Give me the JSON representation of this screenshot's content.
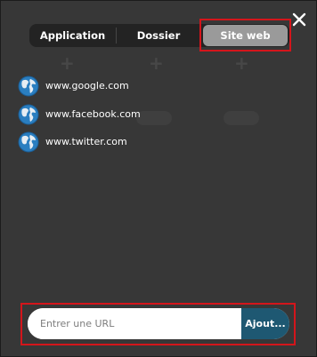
{
  "tabs": {
    "application": "Application",
    "folder": "Dossier",
    "website": "Site web",
    "selected": "website"
  },
  "sites": [
    {
      "label": "www.google.com",
      "icon": "globe-icon"
    },
    {
      "label": "www.facebook.com",
      "icon": "globe-icon"
    },
    {
      "label": "www.twitter.com",
      "icon": "globe-icon"
    }
  ],
  "url_bar": {
    "placeholder": "Entrer une URL",
    "value": "",
    "add_label": "Ajout..."
  },
  "icons": {
    "close": "close-icon",
    "site": "globe-icon"
  },
  "colors": {
    "window_bg": "#373737",
    "tab_bar_bg": "#232323",
    "tab_selected_bg": "#9a9a9a",
    "add_button_bg": "#1e5872",
    "highlight": "#d4151b",
    "globe": "#2a7ec0"
  }
}
